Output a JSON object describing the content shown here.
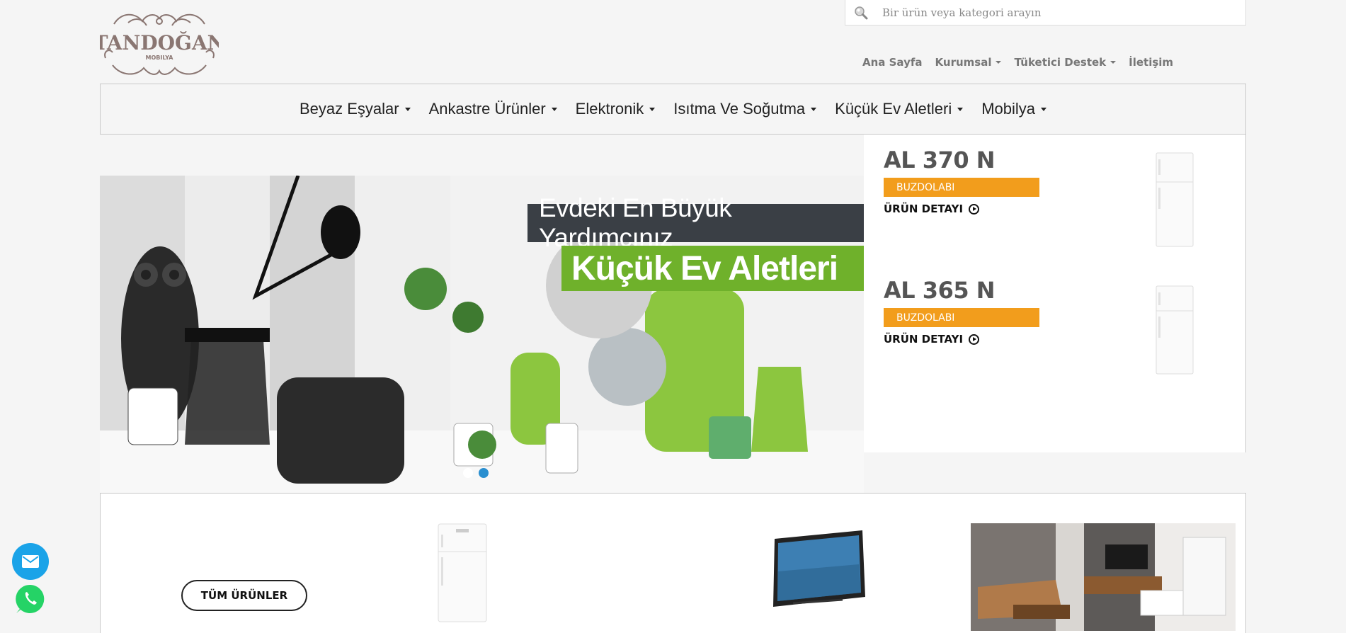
{
  "header": {
    "logo_text": "TANDOĞAN",
    "logo_subtext": "MOBILYA",
    "search": {
      "placeholder": "Bir ürün veya kategori arayın",
      "icon": "search-icon"
    }
  },
  "topnav": [
    {
      "label": "Ana Sayfa",
      "dropdown": false
    },
    {
      "label": "Kurumsal",
      "dropdown": true
    },
    {
      "label": "Tüketici Destek",
      "dropdown": true
    },
    {
      "label": "İletişim",
      "dropdown": false
    }
  ],
  "mainnav": [
    {
      "label": "Beyaz Eşyalar"
    },
    {
      "label": "Ankastre Ürünler"
    },
    {
      "label": "Elektronik"
    },
    {
      "label": "Isıtma Ve Soğutma"
    },
    {
      "label": "Küçük Ev Aletleri"
    },
    {
      "label": "Mobilya"
    }
  ],
  "hero": {
    "line1": "Evdeki En Büyük Yardımcınız",
    "line2": "Küçük Ev Aletleri",
    "slides": 2,
    "active_slide": 1,
    "colors": {
      "accent_green": "#6fb12b",
      "dark_banner": "#3a3f45",
      "dot_active": "#ffffff",
      "dot": "#2a8fd0"
    }
  },
  "products": [
    {
      "name": "AL 370 N",
      "category": "BUZDOLABI",
      "detail_label": "ÜRÜN DETAYI"
    },
    {
      "name": "AL 365 N",
      "category": "BUZDOLABI",
      "detail_label": "ÜRÜN DETAYI"
    }
  ],
  "bottom": {
    "all_products_label": "TÜM ÜRÜNLER",
    "categories": [
      "fridge",
      "television",
      "furniture"
    ]
  },
  "colors": {
    "tag_orange": "#f29d1c",
    "mail_blue": "#1aa3e8",
    "whatsapp_green": "#25d366"
  }
}
